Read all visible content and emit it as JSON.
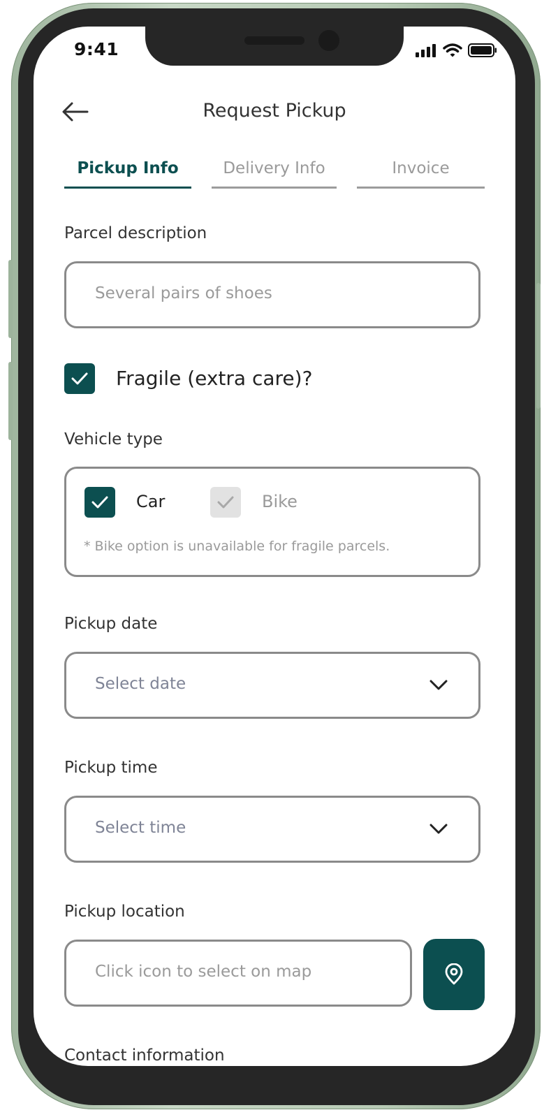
{
  "status_bar": {
    "time": "9:41"
  },
  "header": {
    "title": "Request Pickup"
  },
  "tabs": [
    {
      "label": "Pickup Info",
      "active": true
    },
    {
      "label": "Delivery Info",
      "active": false
    },
    {
      "label": "Invoice",
      "active": false
    }
  ],
  "parcel": {
    "label": "Parcel description",
    "placeholder": "Several pairs of shoes"
  },
  "fragile": {
    "label": "Fragile (extra care)?",
    "checked": true
  },
  "vehicle": {
    "label": "Vehicle type",
    "options": [
      {
        "label": "Car",
        "checked": true,
        "disabled": false
      },
      {
        "label": "Bike",
        "checked": true,
        "disabled": true
      }
    ],
    "note": "* Bike option is unavailable for fragile parcels."
  },
  "pickup_date": {
    "label": "Pickup date",
    "placeholder": "Select date"
  },
  "pickup_time": {
    "label": "Pickup time",
    "placeholder": "Select time"
  },
  "pickup_location": {
    "label": "Pickup location",
    "placeholder": "Click icon to select on map"
  },
  "contact": {
    "label": "Contact information"
  },
  "colors": {
    "accent": "#0c4f50",
    "border": "#8a8a8a",
    "placeholder": "#9a9a9a",
    "frame": "#b7cab5"
  },
  "icons": [
    "back-arrow-icon",
    "check-icon",
    "chevron-down-icon",
    "location-pin-icon",
    "signal-icon",
    "wifi-icon",
    "battery-icon"
  ]
}
